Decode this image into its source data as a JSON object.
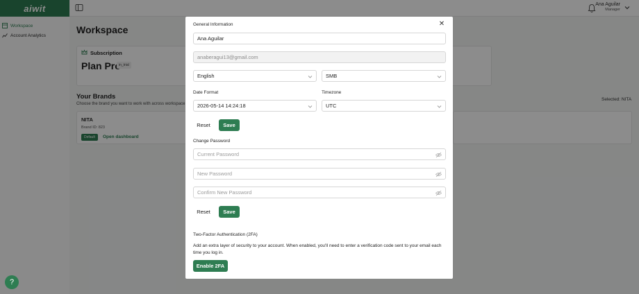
{
  "app": {
    "logo": "aiwit"
  },
  "header": {
    "user_name": "Ana Aguilar",
    "user_role": "Manager"
  },
  "sidebar": {
    "items": [
      {
        "label": "Workspace"
      },
      {
        "label": "Account Analytics"
      }
    ]
  },
  "main": {
    "title": "Workspace",
    "subscription": {
      "title": "Subscription",
      "plan": "Plan Pro",
      "status": "in_trial"
    },
    "brands": {
      "title": "Your Brands",
      "subtitle": "Choose the brand you want to work with across workspace",
      "selected": "Selected: NITA",
      "items": [
        {
          "name": "NITA",
          "brand_id": "Brand ID: 823",
          "badge": "Default",
          "action": "Open dashboard"
        }
      ]
    }
  },
  "modal": {
    "section_general": "General Information",
    "name_value": "Ana Aguilar",
    "email_value": "anaberagui13@gmail.com",
    "language_value": "English",
    "company_size_value": "SMB",
    "date_format_label": "Date Format",
    "date_format_value": "2026-05-14 14:24:18",
    "timezone_label": "Timezone",
    "timezone_value": "UTC",
    "reset_label": "Reset",
    "save_label": "Save",
    "change_password_label": "Change Password",
    "current_password_placeholder": "Current Password",
    "new_password_placeholder": "New Password",
    "confirm_password_placeholder": "Confirm New Password",
    "tfa_title": "Two-Factor Authentication (2FA)",
    "tfa_description": "Add an extra layer of security to your account. When enabled, you'll need to enter a verification code sent to your email each time you log in.",
    "tfa_button": "Enable 2FA"
  },
  "colors": {
    "brand_green": "#2e7d52"
  }
}
